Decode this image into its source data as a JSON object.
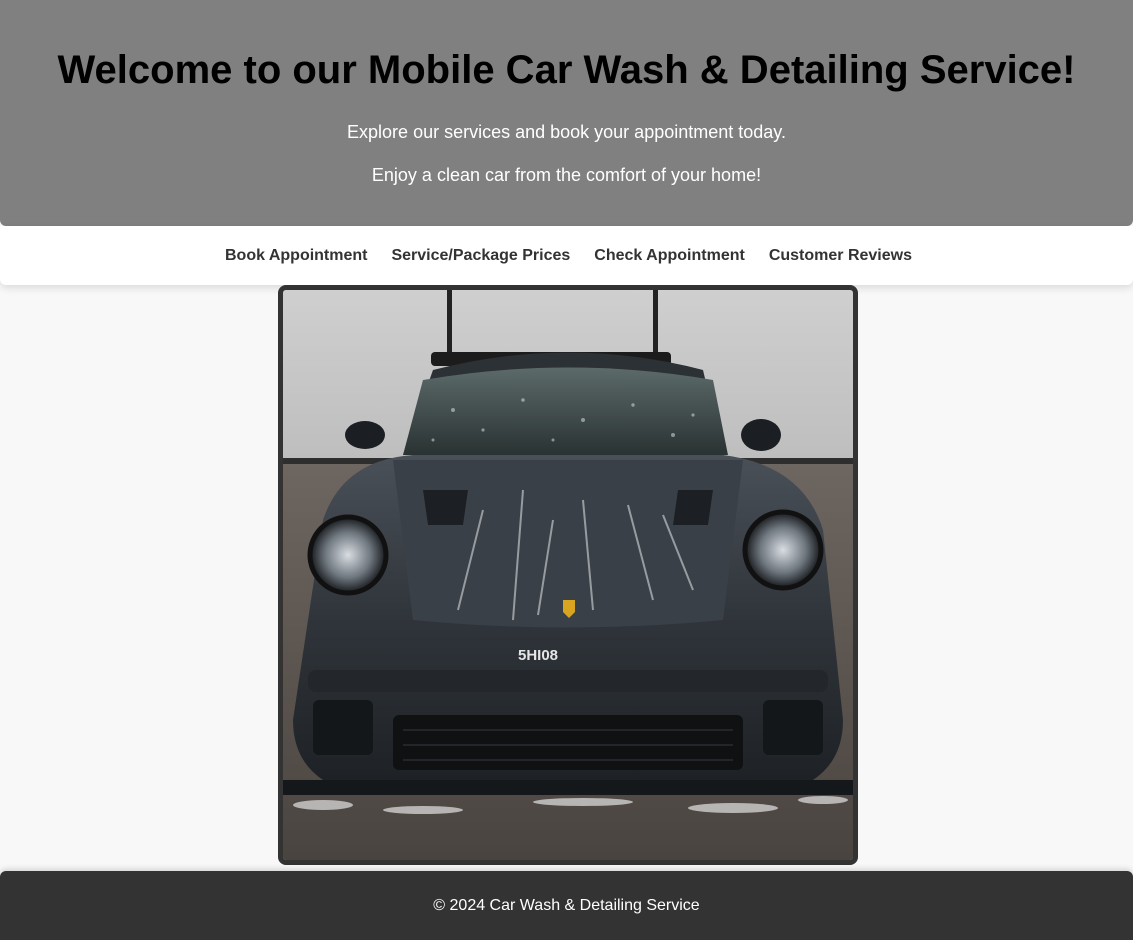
{
  "hero": {
    "title": "Welcome to our Mobile Car Wash & Detailing Service!",
    "line1": "Explore our services and book your appointment today.",
    "line2": "Enjoy a clean car from the comfort of your home!"
  },
  "nav": {
    "items": [
      {
        "label": "Book Appointment"
      },
      {
        "label": "Service/Package Prices"
      },
      {
        "label": "Check Appointment"
      },
      {
        "label": "Customer Reviews"
      }
    ]
  },
  "image": {
    "plate_text": "5HI08"
  },
  "footer": {
    "copyright": "© 2024 Car Wash & Detailing Service"
  },
  "colors": {
    "hero_bg": "#808080",
    "nav_bg": "#ffffff",
    "footer_bg": "#333333",
    "page_bg": "#f8f8f8"
  }
}
